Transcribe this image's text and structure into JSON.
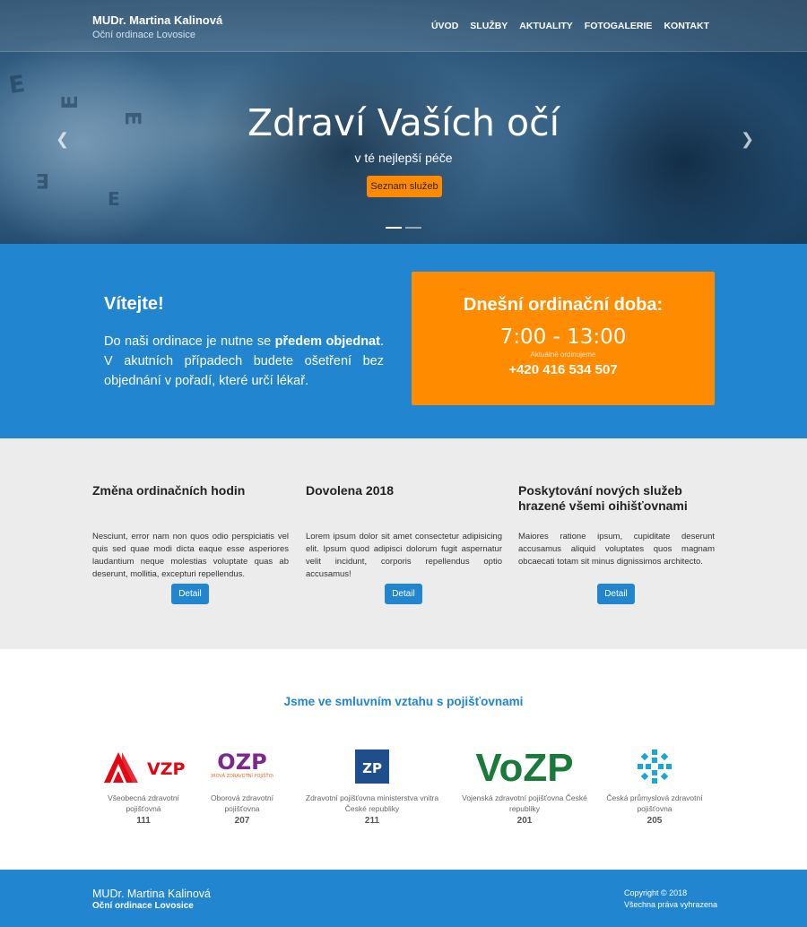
{
  "header": {
    "brand_name": "MUDr. Martina Kalinová",
    "brand_subtitle": "Oční ordinace Lovosice",
    "nav": [
      "ÚVOD",
      "SLUŽBY",
      "AKTUALITY",
      "FOTOGALERIE",
      "KONTAKT"
    ]
  },
  "hero": {
    "title": "Zdraví Vaších očí",
    "subtitle": "v té nejlepší péče",
    "button_label": "Seznam služeb",
    "prev_icon": "chevron-left-icon",
    "next_icon": "chevron-right-icon",
    "slides": 2,
    "active_slide": 1
  },
  "welcome": {
    "heading": "Vítejte!",
    "text_before": "Do naši ordinace je nutne se ",
    "text_bold": "předem objednat",
    "text_after": ". V akutních případech budete ošetření bez objednání v pořadí, které určí lékař."
  },
  "hours": {
    "title": "Dnešní ordinační doba:",
    "time": "7:00 - 13:00",
    "note": "Aktuálně ordinujeme",
    "phone": "+420 416 534 507"
  },
  "news": [
    {
      "title": "Změna ordinačních hodin",
      "text": "Nesciunt, error nam non quos odio perspiciatis vel quis sed quae modi dicta eaque esse asperiores laudantium neque molestias voluptate quas ab deserunt, mollitia, excepturi repellendus.",
      "button": "Detail"
    },
    {
      "title": "Dovolena 2018",
      "text": "Lorem ipsum dolor sit amet consectetur adipisicing elit. Ipsum quod adipisci dolorum fugit aspernatur velit incidunt, corporis repellendus optio accusamus!",
      "button": "Detail"
    },
    {
      "title": "Poskytování nových služeb hrazené všemi oihišťovnami",
      "text": "Maiores ratione ipsum, cupiditate deserunt accusamus aliquid voluptates quos magnam obcaecati totam sit minus dignissimos architecto.",
      "button": "Detail"
    }
  ],
  "insurance": {
    "title": "Jsme ve smluvním vztahu s pojišťovnami",
    "partners": [
      {
        "logo_text": "VZP",
        "name": "Všeobecná zdravotní pojišťovná",
        "code": "111"
      },
      {
        "logo_text": "OZP",
        "logo_sub": "OBOROVÁ ZDRAVOTNÍ POJIŠŤOVNA",
        "name": "Oborová zdravotní pojišťovna",
        "code": "207"
      },
      {
        "logo_text": "ZP",
        "name": "Zdravotní pojišťovna ministerstva vnitra České republiky",
        "code": "211"
      },
      {
        "logo_text": "VoZP",
        "name": "Vojenská zdravotní pojišťovna České republiky",
        "code": "201"
      },
      {
        "logo_text": "",
        "name": "Česká průmyslová zdravotní pojišťovna",
        "code": "205"
      }
    ]
  },
  "footer": {
    "name": "MUDr. Martina Kalinová",
    "subtitle": "Oční ordinace Lovosice",
    "copyright": "Copyright © 2018",
    "rights": "Všechna práva vyhrazena"
  },
  "colors": {
    "primary_blue": "#2185d0",
    "accent_orange": "#ff8c00",
    "news_bg": "#ececec"
  }
}
